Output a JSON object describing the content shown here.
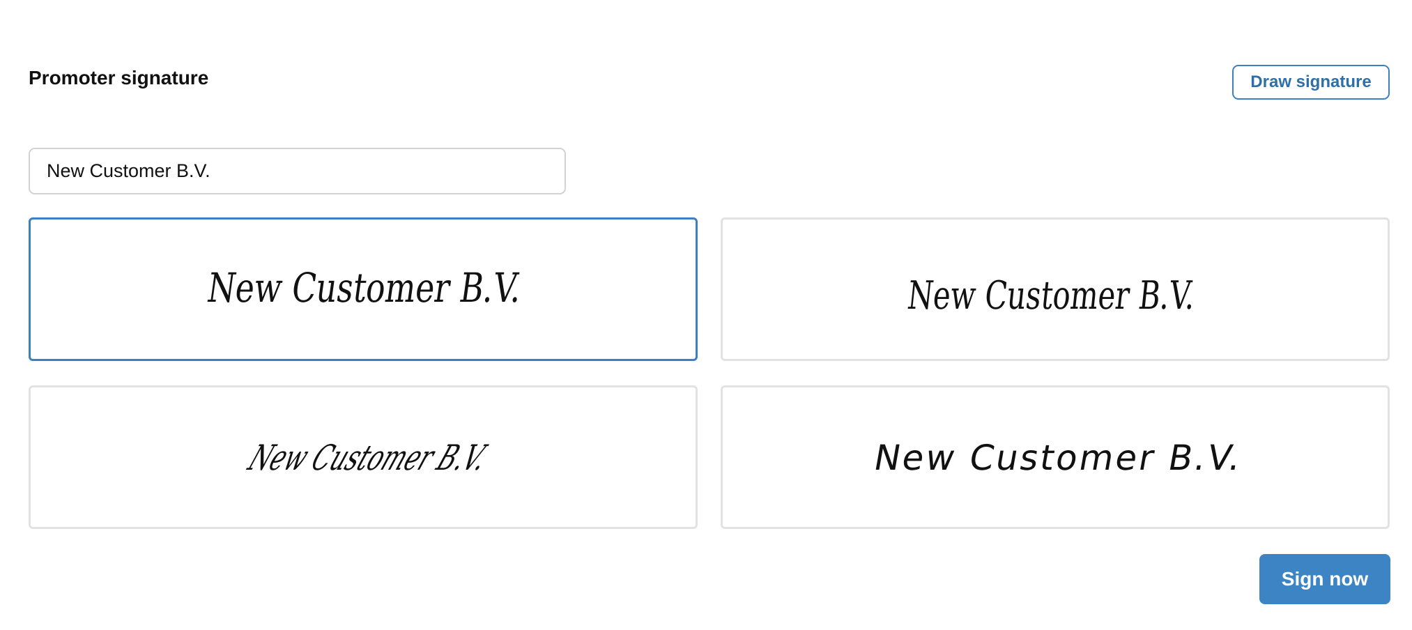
{
  "header": {
    "title": "Promoter signature",
    "draw_signature_label": "Draw signature"
  },
  "name_input": {
    "value": "New Customer B.V."
  },
  "signature_options": [
    {
      "text": "New Customer B.V.",
      "selected": true
    },
    {
      "text": "New Customer B.V.",
      "selected": false
    },
    {
      "text": "New Customer B.V.",
      "selected": false
    },
    {
      "text": "New Customer B.V.",
      "selected": false
    }
  ],
  "footer": {
    "sign_now_label": "Sign now"
  },
  "colors": {
    "accent": "#3d84c4",
    "selected_border": "#3d7fbf",
    "card_border": "#e2e2e2",
    "input_border": "#d2d2d2",
    "text": "#111111"
  }
}
